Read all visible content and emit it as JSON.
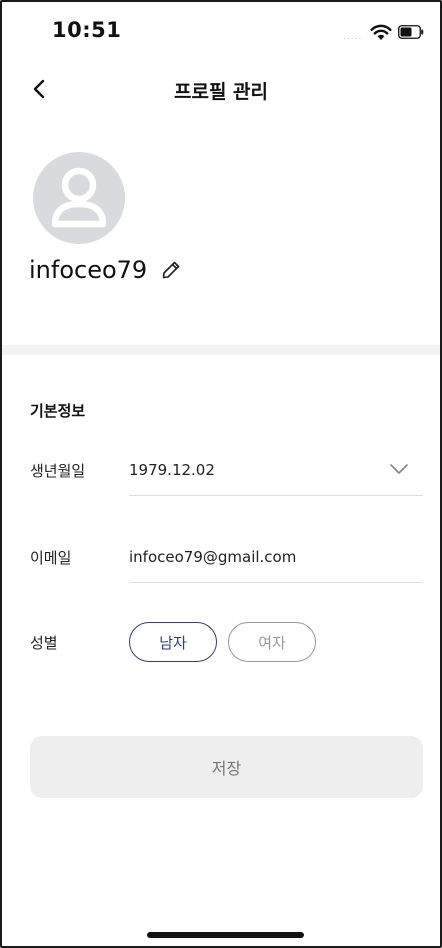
{
  "status_bar": {
    "time": "10:51",
    "signal_dots": "....."
  },
  "header": {
    "title": "프로필 관리",
    "back_icon": "chevron-left-icon"
  },
  "profile": {
    "username": "infoceo79",
    "avatar_icon": "user-placeholder-icon",
    "edit_icon": "pencil-icon"
  },
  "basic_info": {
    "section_title": "기본정보",
    "birthdate": {
      "label": "생년월일",
      "value": "1979.12.02",
      "dropdown_icon": "chevron-down-icon"
    },
    "email": {
      "label": "이메일",
      "value": "infoceo79@gmail.com"
    },
    "gender": {
      "label": "성별",
      "options": [
        "남자",
        "여자"
      ],
      "selected": "남자"
    }
  },
  "actions": {
    "save_label": "저장"
  },
  "colors": {
    "accent": "#2d3d8c",
    "avatar_bg": "#d9dade",
    "divider": "#f3f3f4",
    "save_bg": "#eeeeef"
  }
}
